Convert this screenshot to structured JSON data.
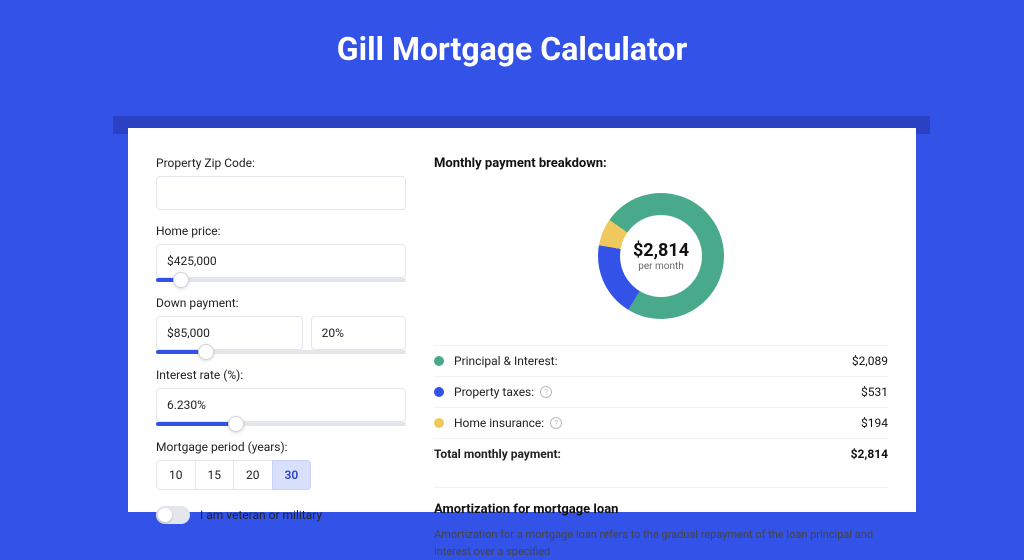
{
  "colors": {
    "accent": "#3252e8",
    "green": "#49a98b",
    "blue": "#3252e8",
    "yellow": "#efc85e"
  },
  "header": {
    "title": "Gill Mortgage Calculator"
  },
  "form": {
    "zip": {
      "label": "Property Zip Code:",
      "value": ""
    },
    "price": {
      "label": "Home price:",
      "value": "$425,000",
      "slider_pct": 10
    },
    "down": {
      "label": "Down payment:",
      "amount": "$85,000",
      "pct": "20%",
      "slider_pct": 20
    },
    "rate": {
      "label": "Interest rate (%):",
      "value": "6.230%",
      "slider_pct": 32
    },
    "period": {
      "label": "Mortgage period (years):",
      "options": [
        "10",
        "15",
        "20",
        "30"
      ],
      "selected": "30"
    },
    "veteran": {
      "label": "I am veteran or military",
      "on": false
    }
  },
  "breakdown": {
    "title": "Monthly payment breakdown:",
    "center_value": "$2,814",
    "center_sub": "per month",
    "items": [
      {
        "label": "Principal & Interest:",
        "amount": "$2,089",
        "color": "#49a98b",
        "pct": 74,
        "info": false
      },
      {
        "label": "Property taxes:",
        "amount": "$531",
        "color": "#3252e8",
        "pct": 19,
        "info": true
      },
      {
        "label": "Home insurance:",
        "amount": "$194",
        "color": "#efc85e",
        "pct": 7,
        "info": true
      }
    ],
    "total": {
      "label": "Total monthly payment:",
      "amount": "$2,814"
    }
  },
  "amort": {
    "heading": "Amortization for mortgage loan",
    "text": "Amortization for a mortgage loan refers to the gradual repayment of the loan principal and interest over a specified"
  },
  "chart_data": {
    "type": "pie",
    "title": "Monthly payment breakdown",
    "categories": [
      "Principal & Interest",
      "Property taxes",
      "Home insurance"
    ],
    "values": [
      2089,
      531,
      194
    ],
    "colors": [
      "#49a98b",
      "#3252e8",
      "#efc85e"
    ],
    "total": 2814,
    "center_label": "$2,814 per month"
  }
}
